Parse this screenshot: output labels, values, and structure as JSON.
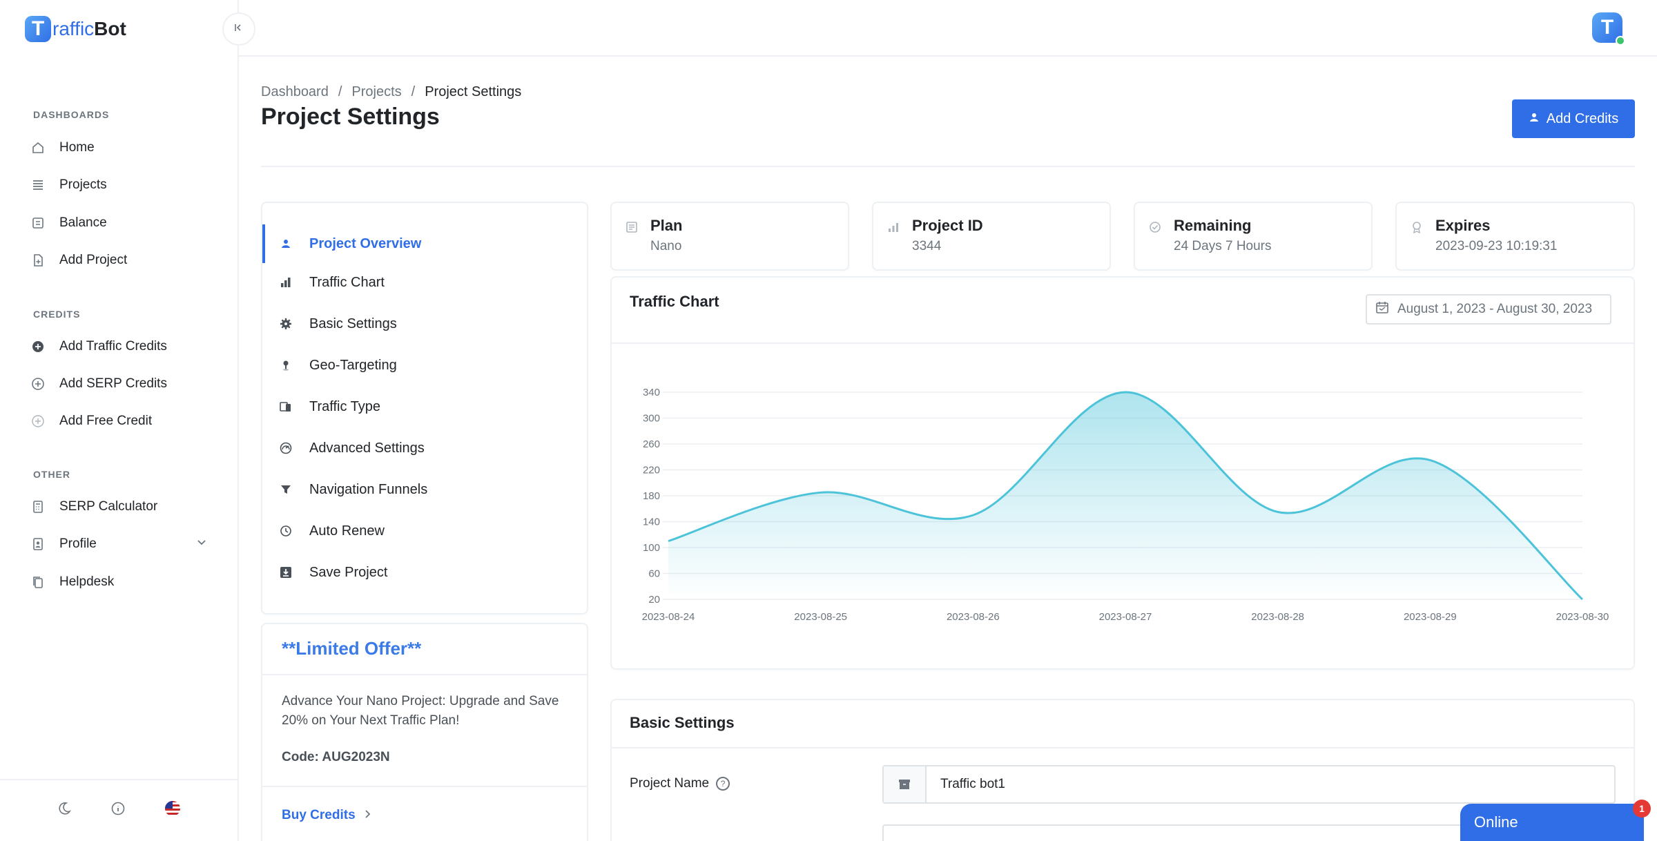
{
  "app": {
    "logo_letter": "T",
    "logo_text_a": "raffic",
    "logo_text_b": "Bot",
    "avatar_letter": "T"
  },
  "sidebar": {
    "sections": [
      {
        "label": "DASHBOARDS",
        "items": [
          {
            "label": "Home",
            "icon": "home-icon"
          },
          {
            "label": "Projects",
            "icon": "list-icon"
          },
          {
            "label": "Balance",
            "icon": "wallet-icon"
          },
          {
            "label": "Add Project",
            "icon": "file-plus-icon"
          }
        ]
      },
      {
        "label": "CREDITS",
        "items": [
          {
            "label": "Add Traffic Credits",
            "icon": "plus-circle-filled-icon"
          },
          {
            "label": "Add SERP Credits",
            "icon": "plus-circle-icon"
          },
          {
            "label": "Add Free Credit",
            "icon": "plus-circle-light-icon"
          }
        ]
      },
      {
        "label": "OTHER",
        "items": [
          {
            "label": "SERP Calculator",
            "icon": "calculator-icon"
          },
          {
            "label": "Profile",
            "icon": "user-card-icon"
          },
          {
            "label": "Helpdesk",
            "icon": "copy-icon"
          }
        ]
      }
    ]
  },
  "breadcrumb": [
    "Dashboard",
    "Projects",
    "Project Settings"
  ],
  "page_title": "Project Settings",
  "header_button": "Add Credits",
  "settings_menu": [
    {
      "label": "Project Overview",
      "active": true
    },
    {
      "label": "Traffic Chart"
    },
    {
      "label": "Basic Settings"
    },
    {
      "label": "Geo-Targeting"
    },
    {
      "label": "Traffic Type"
    },
    {
      "label": "Advanced Settings"
    },
    {
      "label": "Navigation Funnels"
    },
    {
      "label": "Auto Renew"
    },
    {
      "label": "Save Project"
    }
  ],
  "offer": {
    "title": "**Limited Offer**",
    "text": "Advance Your Nano Project: Upgrade and Save 20% on Your Next Traffic Plan!",
    "code": "Code: AUG2023N",
    "link": "Buy Credits"
  },
  "info_cards": [
    {
      "label": "Plan",
      "value": "Nano"
    },
    {
      "label": "Project ID",
      "value": "3344"
    },
    {
      "label": "Remaining",
      "value": "24 Days 7 Hours"
    },
    {
      "label": "Expires",
      "value": "2023-09-23 10:19:31"
    }
  ],
  "traffic_chart": {
    "title": "Traffic Chart",
    "date_range": "August 1, 2023 - August 30, 2023"
  },
  "chart_data": {
    "type": "area",
    "x": [
      "2023-08-24",
      "2023-08-25",
      "2023-08-26",
      "2023-08-27",
      "2023-08-28",
      "2023-08-29",
      "2023-08-30"
    ],
    "values": [
      110,
      185,
      150,
      340,
      155,
      235,
      20
    ],
    "y_ticks": [
      20,
      60,
      100,
      140,
      180,
      220,
      260,
      300,
      340
    ],
    "ylim": [
      20,
      340
    ],
    "grid": true,
    "color": "#4cc3d9"
  },
  "basic_settings": {
    "title": "Basic Settings",
    "project_name_label": "Project Name",
    "project_name_value": "Traffic bot1"
  },
  "chat": {
    "label": "Online",
    "badge": "1"
  },
  "colors": {
    "primary": "#2f6ee6",
    "chart_line": "#4cc3d9",
    "status_online": "#3cc46f"
  }
}
